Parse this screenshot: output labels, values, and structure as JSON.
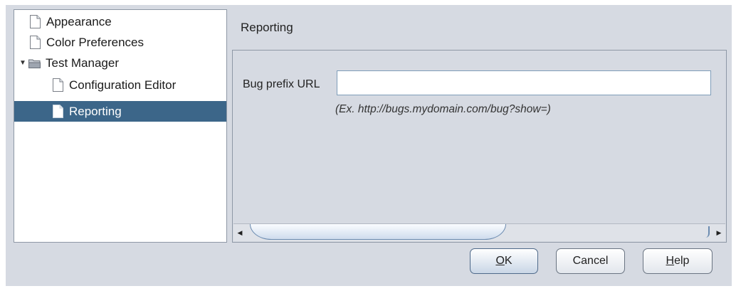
{
  "tree": {
    "items": [
      {
        "label": "Appearance",
        "level": 0,
        "type": "page",
        "selected": false
      },
      {
        "label": "Color Preferences",
        "level": 0,
        "type": "page",
        "selected": false
      },
      {
        "label": "Test Manager",
        "level": 0,
        "type": "folder",
        "expanded": true,
        "selected": false
      },
      {
        "label": "Configuration Editor",
        "level": 1,
        "type": "page",
        "selected": false
      },
      {
        "label": "Reporting",
        "level": 1,
        "type": "page",
        "selected": true
      }
    ]
  },
  "panel": {
    "title": "Reporting",
    "bug_prefix_label": "Bug prefix URL",
    "bug_prefix_value": "",
    "hint": "(Ex. http://bugs.mydomain.com/bug?show=)"
  },
  "buttons": {
    "ok_mnemonic": "O",
    "ok_rest": "K",
    "cancel_label": "Cancel",
    "help_mnemonic": "H",
    "help_rest": "elp"
  },
  "colors": {
    "selection": "#3c6689",
    "background": "#d6dae2"
  }
}
